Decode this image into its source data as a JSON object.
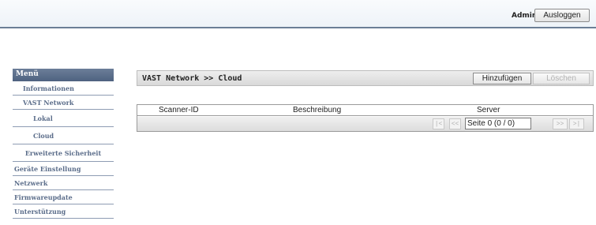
{
  "header": {
    "user_label": "Admin",
    "logout_label": "Ausloggen"
  },
  "sidebar": {
    "title": "Menü",
    "items": [
      {
        "label": "Informationen"
      },
      {
        "label": "VAST Network"
      },
      {
        "label": "Lokal"
      },
      {
        "label": "Cloud"
      },
      {
        "label": "Erweiterte Sicherheit"
      },
      {
        "label": "Geräte Einstellung"
      },
      {
        "label": "Netzwerk"
      },
      {
        "label": "Firmwareupdate"
      },
      {
        "label": "Unterstützung"
      }
    ]
  },
  "main": {
    "breadcrumb": "VAST Network >> Cloud",
    "add_label": "Hinzufügen",
    "delete_label": "Löschen"
  },
  "table": {
    "columns": [
      "Scanner-ID",
      "Beschreibung",
      "Server"
    ],
    "rows": []
  },
  "pager": {
    "first": "|<",
    "prev": "<<",
    "page_text": "Seite 0 (0 / 0)",
    "next": ">>",
    "last": ">|"
  }
}
